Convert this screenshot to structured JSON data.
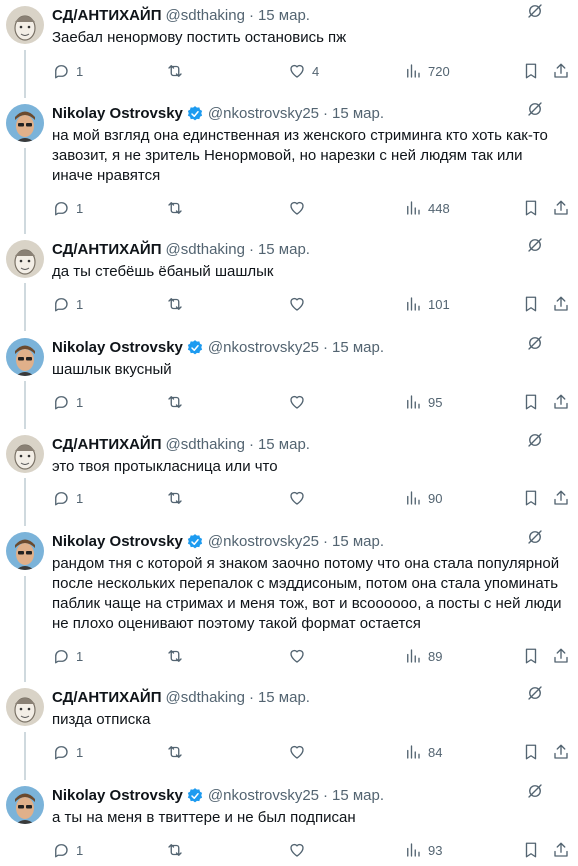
{
  "accounts": {
    "sd": {
      "name": "СД/АНТИХАЙП",
      "handle": "@sdthaking"
    },
    "nik": {
      "name": "Nikolay Ostrovsky",
      "handle": "@nkostrovsky25"
    }
  },
  "dot": "·",
  "tweets": [
    {
      "author": "sd",
      "date": "15 мар.",
      "text": "Заебал ненормову постить остановись пж",
      "replies": "1",
      "likes": "4",
      "views": "720"
    },
    {
      "author": "nik",
      "date": "15 мар.",
      "text": "на мой взгляд она единственная из женского стриминга кто хоть как-то завозит, я не зритель Ненормовой, но нарезки с ней людям так или иначе нравятся",
      "replies": "1",
      "likes": "",
      "views": "448"
    },
    {
      "author": "sd",
      "date": "15 мар.",
      "text": "да ты стебёшь ёбаный шашлык",
      "replies": "1",
      "likes": "",
      "views": "101"
    },
    {
      "author": "nik",
      "date": "15 мар.",
      "text": "шашлык вкусный",
      "replies": "1",
      "likes": "",
      "views": "95"
    },
    {
      "author": "sd",
      "date": "15 мар.",
      "text": "это твоя протыкласница или что",
      "replies": "1",
      "likes": "",
      "views": "90"
    },
    {
      "author": "nik",
      "date": "15 мар.",
      "text": "рандом тня с которой я знаком заочно потому что она стала популярной после нескольких перепалок с мэддисоным, потом она стала упоминать паблик чаще на стримах и меня тож, вот и всоооооо, а посты с ней люди не плохо оценивают поэтому такой формат остается",
      "replies": "1",
      "likes": "",
      "views": "89"
    },
    {
      "author": "sd",
      "date": "15 мар.",
      "text": "пизда отписка",
      "replies": "1",
      "likes": "",
      "views": "84"
    },
    {
      "author": "nik",
      "date": "15 мар.",
      "text": "а ты на меня в твиттере и не был подписан",
      "replies": "1",
      "likes": "",
      "views": "93"
    }
  ],
  "icons": {
    "reply": "reply-icon",
    "retweet": "retweet-icon",
    "like": "heart-icon",
    "views": "views-chart-icon",
    "bookmark": "bookmark-icon",
    "share": "share-icon",
    "more": "grok-icon",
    "verified": "verified-badge-icon"
  },
  "colors": {
    "text": "#0f1419",
    "muted": "#536471",
    "verified": "#1d9bf0",
    "line": "#cfd9de"
  }
}
